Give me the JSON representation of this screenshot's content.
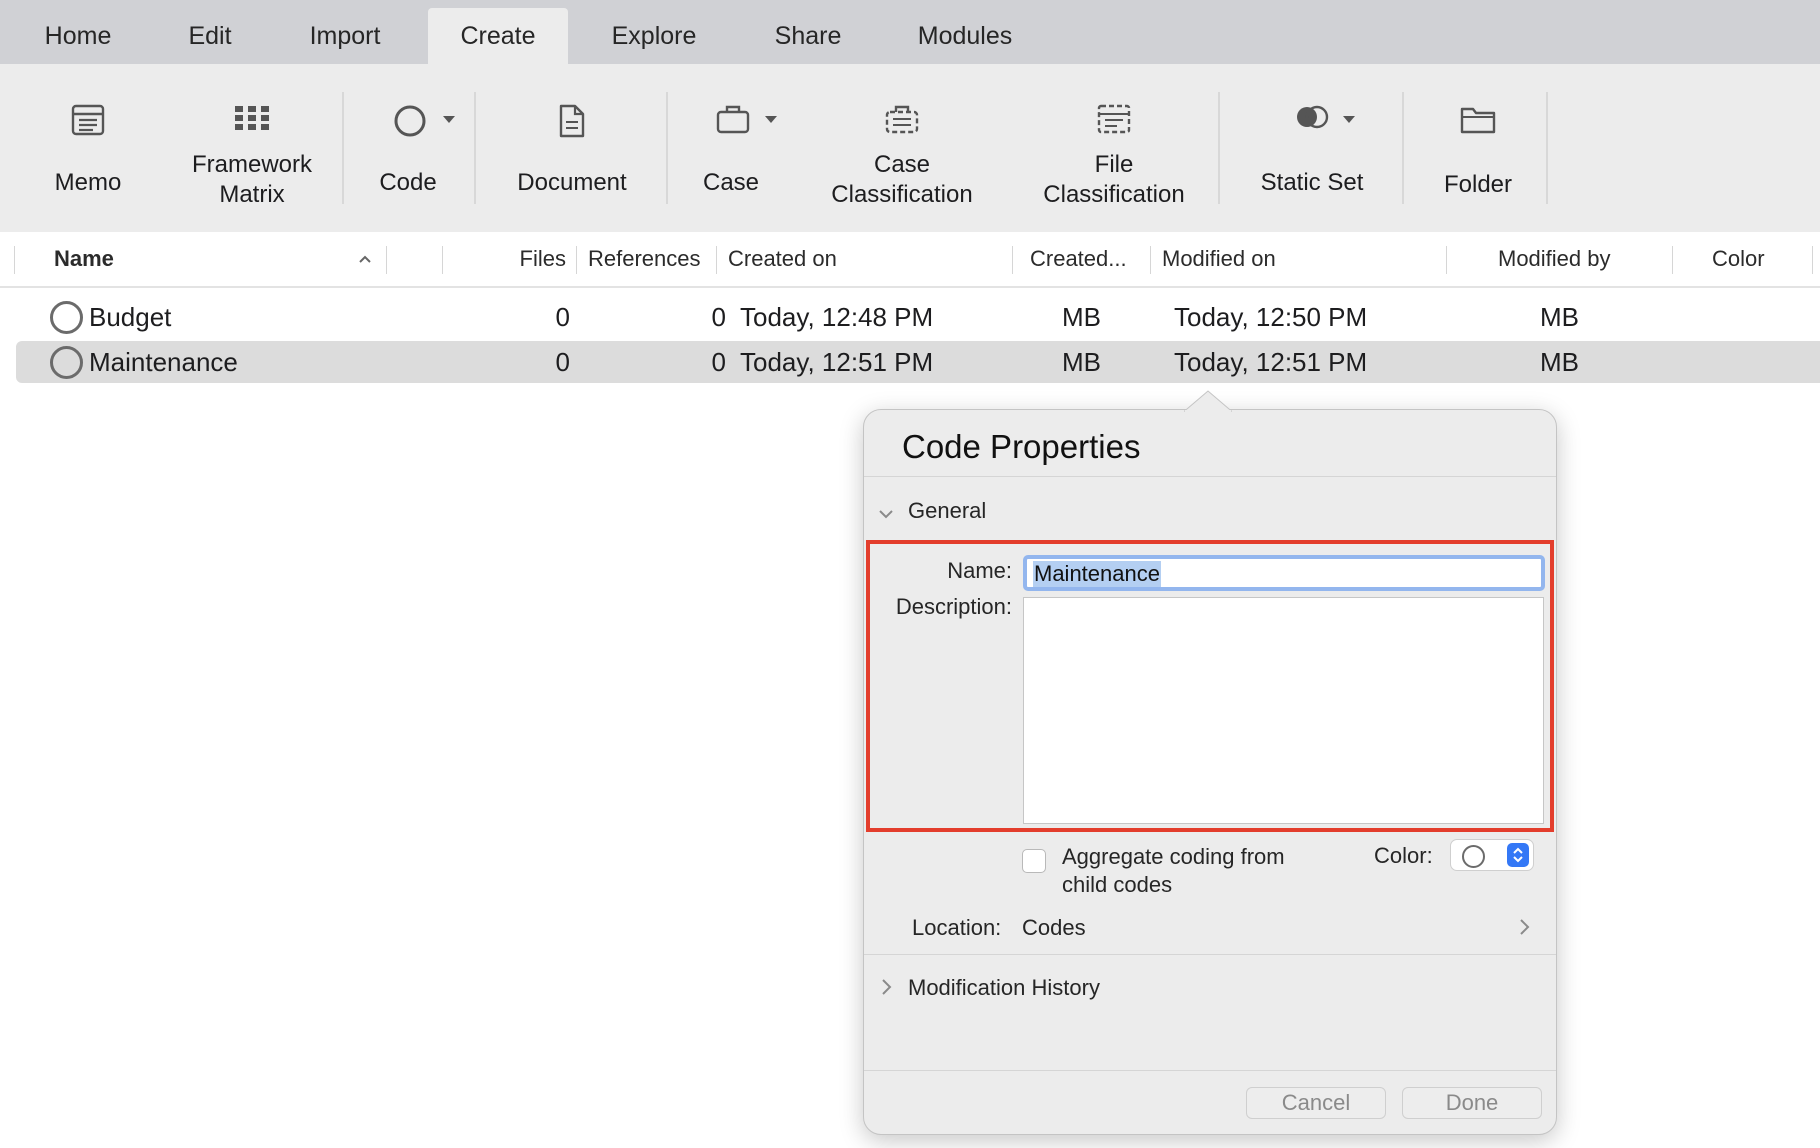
{
  "menu": {
    "tabs": [
      "Home",
      "Edit",
      "Import",
      "Create",
      "Explore",
      "Share",
      "Modules"
    ],
    "active": "Create"
  },
  "ribbon": {
    "memo": "Memo",
    "framework_matrix": [
      "Framework",
      "Matrix"
    ],
    "code": "Code",
    "document": "Document",
    "case": "Case",
    "case_classification": [
      "Case",
      "Classification"
    ],
    "file_classification": [
      "File",
      "Classification"
    ],
    "static_set": "Static Set",
    "folder": "Folder"
  },
  "list": {
    "columns": [
      "Name",
      "Files",
      "References",
      "Created on",
      "Created...",
      "Modified on",
      "Modified by",
      "Color"
    ],
    "rows": [
      {
        "name": "Budget",
        "files": "0",
        "references": "0",
        "created_on": "Today, 12:48 PM",
        "created_by": "MB",
        "modified_on": "Today, 12:50 PM",
        "modified_by": "MB"
      },
      {
        "name": "Maintenance",
        "files": "0",
        "references": "0",
        "created_on": "Today, 12:51 PM",
        "created_by": "MB",
        "modified_on": "Today, 12:51 PM",
        "modified_by": "MB"
      }
    ],
    "selected_index": 1
  },
  "popover": {
    "title": "Code Properties",
    "general": "General",
    "name_label": "Name:",
    "name_value": "Maintenance",
    "description_label": "Description:",
    "aggregate_label": [
      "Aggregate coding from",
      "child codes"
    ],
    "color_label": "Color:",
    "location_label": "Location:",
    "location_value": "Codes",
    "modification_history": "Modification History",
    "cancel": "Cancel",
    "done": "Done"
  },
  "colors": {
    "highlight": "#e33d2c",
    "selection_blue": "#3478f6",
    "menubar": "#d0d1d5",
    "ribbon": "#ececec"
  }
}
